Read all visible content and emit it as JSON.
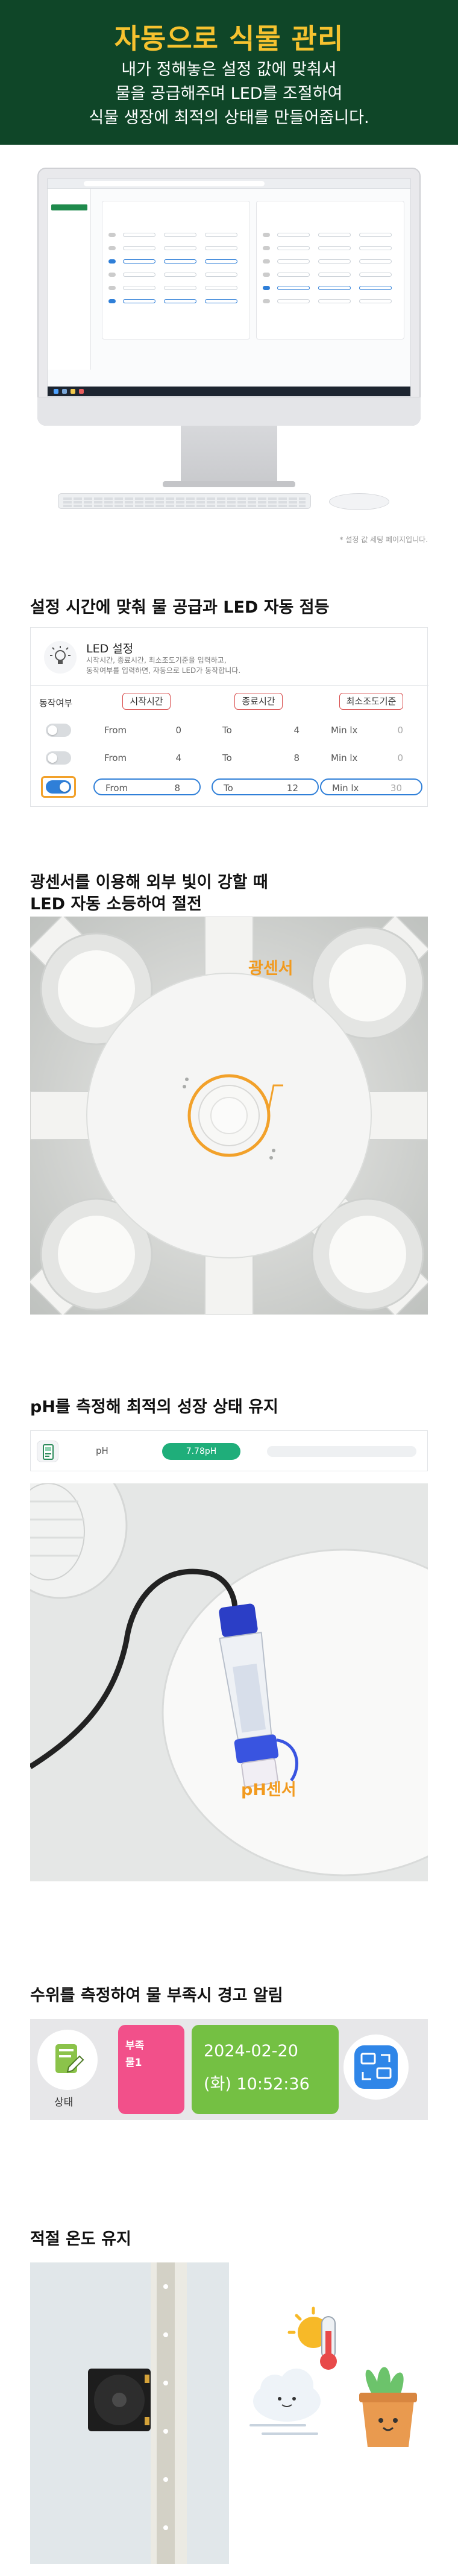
{
  "hero": {
    "title": "자동으로 식물 관리",
    "line1": "내가 정해놓은 설정 값에 맞춰서",
    "line2": "물을 공급해주며 LED를 조절하여",
    "line3": "식물 생장에 최적의 상태를 만들어줍니다."
  },
  "monitor": {
    "caption": "* 설정 값 세팅 페이지입니다."
  },
  "led_section": {
    "heading": "설정 시간에 맞춰 물 공급과 LED 자동 점등",
    "panel_title": "LED 설정",
    "panel_desc_1": "시작시간, 종료시간, 최소조도기준을 입력하고,",
    "panel_desc_2": "동작여부를 입력하면, 자동으로 LED가 동작합니다.",
    "col_active": "동작여부",
    "col_start": "시작시간",
    "col_end": "종료시간",
    "col_min_lux": "최소조도기준",
    "from_label": "From",
    "to_label": "To",
    "lux_label": "Min lx",
    "rows": [
      {
        "active": false,
        "from": "0",
        "to": "4",
        "lux": "0"
      },
      {
        "active": false,
        "from": "4",
        "to": "8",
        "lux": "0"
      },
      {
        "active": true,
        "from": "8",
        "to": "12",
        "lux": "30"
      }
    ]
  },
  "light_section": {
    "heading_1": "광센서를 이용해 외부 빛이 강할 때",
    "heading_2": "LED 자동 소등하여 절전",
    "callout": "광센서"
  },
  "ph_section": {
    "heading": "pH를 측정해 최적의 성장 상태 유지",
    "label": "pH",
    "value": "7.78pH",
    "callout": "pH센서"
  },
  "water_section": {
    "heading": "수위를 측정하여 물 부족시 경고 알림",
    "status_label": "상태",
    "alert_1": "부족",
    "alert_2": "물1",
    "date": "2024-02-20",
    "time": "(화) 10:52:36"
  },
  "temp_section": {
    "heading": "적절 온도 유지"
  },
  "colors": {
    "brand_green": "#0f4628",
    "accent_yellow": "#f6c22f",
    "callout_orange": "#f29a1e",
    "toggle_blue": "#2f7fd8",
    "ph_green": "#1fae7a",
    "alert_pink": "#f2508a",
    "time_green": "#74c043"
  }
}
